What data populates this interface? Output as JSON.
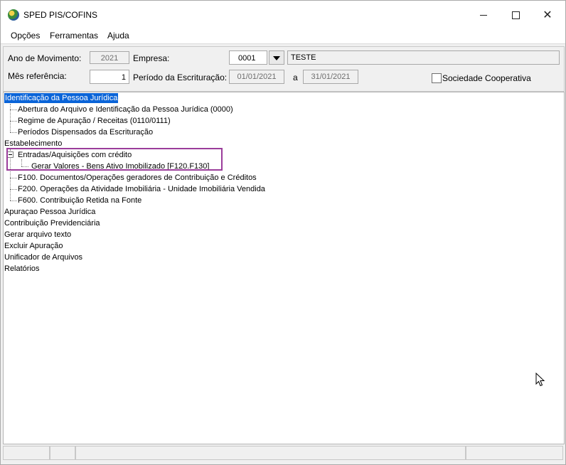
{
  "window": {
    "title": "SPED PIS/COFINS"
  },
  "menu": {
    "items": [
      "Opções",
      "Ferramentas",
      "Ajuda"
    ]
  },
  "form": {
    "ano_label": "Ano de Movimento:",
    "ano_value": "2021",
    "empresa_label": "Empresa:",
    "empresa_code": "0001",
    "empresa_name": "TESTE",
    "mes_label": "Mês referência:",
    "mes_value": "1",
    "periodo_label": "Período da Escrituração:",
    "periodo_start": "01/01/2021",
    "periodo_sep": "a",
    "periodo_end": "31/01/2021",
    "cooperativa_label": "Sociedade Cooperativa",
    "cooperativa_checked": false
  },
  "tree": {
    "items": [
      "Identificação da Pessoa Jurídica",
      "Abertura do Arquivo e Identificação da Pessoa Jurídica (0000)",
      "Regime de Apuração / Receitas (0110/0111)",
      "Períodos Dispensados da Escrituração",
      "Estabelecimento",
      "Entradas/Aquisições com crédito",
      "Gerar Valores - Bens Ativo Imobilizado   [F120.F130]",
      "F100. Documentos/Operações geradores de Contribuição e Créditos",
      "F200. Operações da Atividade Imobiliária - Unidade Imobiliária Vendida",
      "F600. Contribuição Retida na Fonte",
      "Apuraçao Pessoa Jurídica",
      "Contribuição Previdenciária",
      "Gerar arquivo texto",
      "Excluir Apuração",
      "Unificador de Arquivos",
      "Relatórios"
    ],
    "selected": "Identificação da Pessoa Jurídica"
  },
  "colors": {
    "selection": "#0a64d8",
    "highlight_box": "#9b3d9b"
  },
  "icons": {
    "app": "sped-app-icon",
    "cursor": "mouse-pointer-icon"
  }
}
